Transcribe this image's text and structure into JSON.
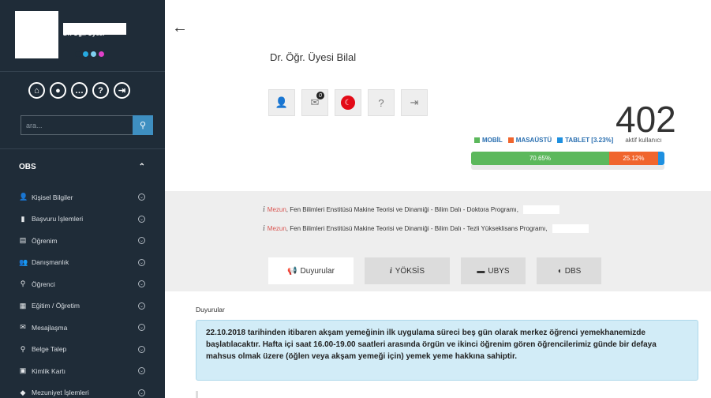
{
  "sidebar": {
    "role": "Dr. Öğr. Üyesi",
    "dot_colors": [
      "#1f2c38",
      "#26a9e0",
      "#7fd0f0",
      "#e040c8"
    ],
    "icons": [
      "home-icon",
      "user-icon",
      "chat-icon",
      "help-icon",
      "logout-icon"
    ],
    "search_placeholder": "ara...",
    "section_title": "OBS",
    "items": [
      {
        "label": "Kişisel Bilgiler",
        "glyph": "👤"
      },
      {
        "label": "Başvuru İşlemleri",
        "glyph": "▮"
      },
      {
        "label": "Öğrenim",
        "glyph": "▤"
      },
      {
        "label": "Danışmanlık",
        "glyph": "👥"
      },
      {
        "label": "Öğrenci",
        "glyph": "⚲"
      },
      {
        "label": "Eğitim / Öğretim",
        "glyph": "▦"
      },
      {
        "label": "Mesajlaşma",
        "glyph": "✉"
      },
      {
        "label": "Belge Talep",
        "glyph": "⚲"
      },
      {
        "label": "Kimlik Kartı",
        "glyph": "▣"
      },
      {
        "label": "Mezuniyet İşlemleri",
        "glyph": "◆"
      }
    ]
  },
  "header": {
    "title": "Dr. Öğr. Üyesi Bilal",
    "message_count": "0",
    "help": "?"
  },
  "stats": {
    "count": "402",
    "legend_mobile": "MOBİL",
    "legend_desktop": "MASAÜSTÜ",
    "legend_tablet": "TABLET [3.23%]",
    "legend_suffix": "aktif kullanıcı",
    "mobile_pct": "70.65%",
    "desktop_pct": "25.12%",
    "mobile_value": 70.65,
    "desktop_value": 25.12,
    "tablet_value": 3.23,
    "colors": {
      "mobile": "#5cb85c",
      "desktop": "#f0652d",
      "tablet": "#1e90e0"
    }
  },
  "info": [
    {
      "status": "Mezun",
      "text": ", Fen Bilimleri Enstitüsü Makine Teorisi ve Dinamiği - Bilim Dalı - Doktora Programı,"
    },
    {
      "status": "Mezun",
      "text": ", Fen Bilimleri Enstitüsü Makine Teorisi ve Dinamiği - Bilim Dalı - Tezli Yükseklisans Programı,"
    }
  ],
  "tabs": [
    {
      "label": "Duyurular",
      "glyph": "📢"
    },
    {
      "label": "YÖKSİS",
      "glyph": "i"
    },
    {
      "label": "UBYS",
      "glyph": "▬"
    },
    {
      "label": "DBS",
      "glyph": "◖"
    }
  ],
  "panel": {
    "title": "Duyurular",
    "announcement": "22.10.2018 tarihinden itibaren akşam yemeğinin ilk uygulama süreci beş gün olarak merkez öğrenci yemekhanemizde başlatılacaktır. Hafta içi saat 16.00-19.00 saatleri arasında örgün ve ikinci öğrenim gören öğrencilerimiz günde bir defaya mahsus olmak üzere (öğlen veya akşam yemeği için) yemek yeme hakkına sahiptir."
  }
}
